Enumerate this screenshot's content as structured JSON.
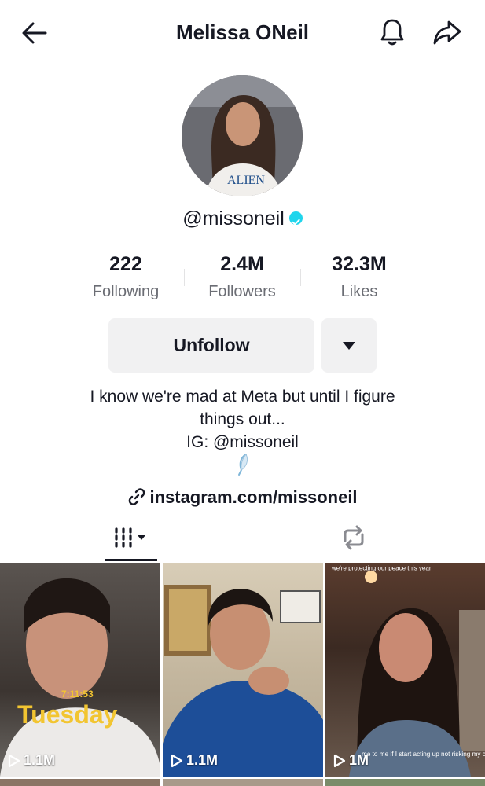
{
  "header": {
    "title": "Melissa ONeil"
  },
  "profile": {
    "username": "@missoneil"
  },
  "stats": [
    {
      "value": "222",
      "label": "Following"
    },
    {
      "value": "2.4M",
      "label": "Followers"
    },
    {
      "value": "32.3M",
      "label": "Likes"
    }
  ],
  "actions": {
    "unfollow_label": "Unfollow"
  },
  "bio": {
    "line1": "I know we're mad at Meta but until I figure",
    "line2": "things out...",
    "line3": "IG: @missoneil"
  },
  "link": {
    "text": "instagram.com/missoneil"
  },
  "videos": [
    {
      "views": "1.1M",
      "overlay_time": "7:11:53",
      "overlay_text": "Tuesday"
    },
    {
      "views": "1.1M"
    },
    {
      "views": "1M",
      "overlay_top": "we're protecting our peace this year",
      "overlay_bottom": "me to me if I start acting up not risking my cortisol for a damn thing."
    }
  ],
  "colors": {
    "verified": "#20d5ec",
    "text": "#161823",
    "secondary": "#6b6d74",
    "button_bg": "#f1f1f2"
  }
}
